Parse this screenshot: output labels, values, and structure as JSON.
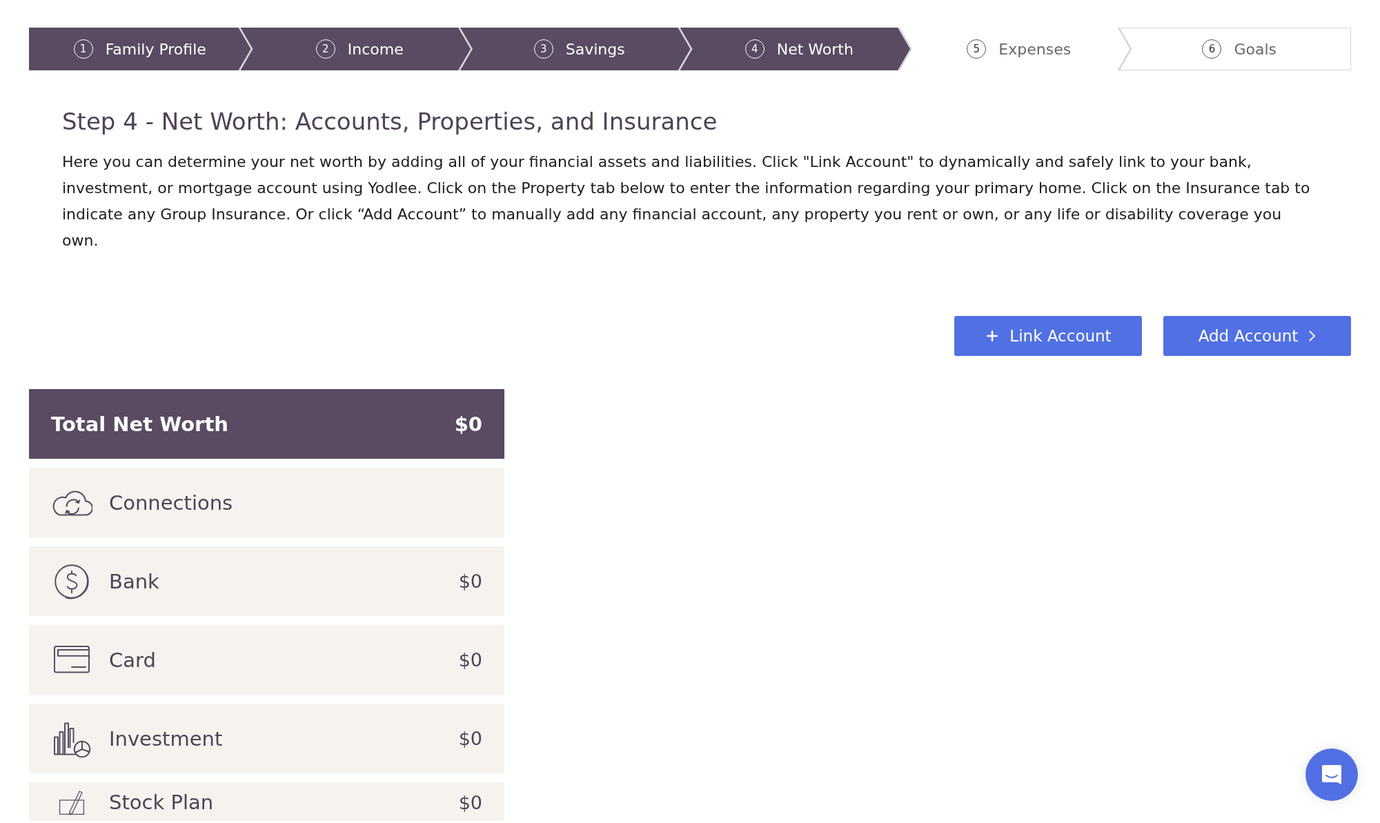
{
  "steps": [
    {
      "number": "1",
      "label": "Family Profile",
      "completed": true
    },
    {
      "number": "2",
      "label": "Income",
      "completed": true
    },
    {
      "number": "3",
      "label": "Savings",
      "completed": true
    },
    {
      "number": "4",
      "label": "Net Worth",
      "completed": true
    },
    {
      "number": "5",
      "label": "Expenses",
      "completed": false
    },
    {
      "number": "6",
      "label": "Goals",
      "completed": false
    }
  ],
  "heading": "Step 4 - Net Worth: Accounts, Properties, and Insurance",
  "intro": "Here you can determine your net worth by adding all of your financial assets and liabilities. Click \"Link Account\" to dynamically and safely link to your bank, investment, or mortgage account using Yodlee. Click on the Property tab below to enter the information regarding your primary home. Click on the Insurance tab to indicate any Group Insurance. Or click “Add Account” to manually add any financial account, any property you rent or own, or any life or disability coverage you own.",
  "buttons": [
    {
      "kind": "link",
      "label": "Link Account"
    },
    {
      "kind": "add",
      "label": "Add Account"
    }
  ],
  "total": {
    "label": "Total Net Worth",
    "value": "$0"
  },
  "categories": [
    {
      "kind": "connections",
      "label": "Connections"
    },
    {
      "kind": "bank",
      "label": "Bank",
      "value": "$0"
    },
    {
      "kind": "card",
      "label": "Card",
      "value": "$0"
    },
    {
      "kind": "investment",
      "label": "Investment",
      "value": "$0"
    },
    {
      "kind": "stock",
      "label": "Stock Plan",
      "value": "$0"
    }
  ]
}
